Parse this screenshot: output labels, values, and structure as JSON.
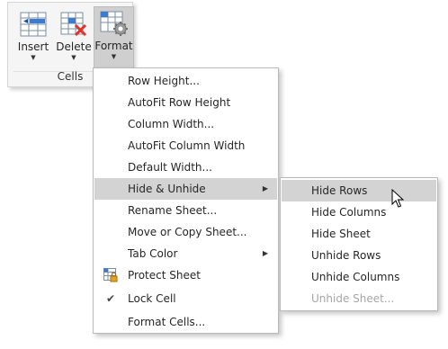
{
  "ribbon": {
    "group_label": "Cells",
    "buttons": [
      {
        "label": "Insert",
        "icon": "insert-cells-icon"
      },
      {
        "label": "Delete",
        "icon": "delete-cells-icon"
      },
      {
        "label": "Format",
        "icon": "format-cells-icon"
      }
    ]
  },
  "menu": {
    "items": [
      {
        "label": "Row Height..."
      },
      {
        "label": "AutoFit Row Height"
      },
      {
        "label": "Column Width..."
      },
      {
        "label": "AutoFit Column Width"
      },
      {
        "label": "Default Width..."
      },
      {
        "label": "Hide & Unhide",
        "submenu": true,
        "highlighted": true
      },
      {
        "label": "Rename Sheet..."
      },
      {
        "label": "Move or Copy Sheet..."
      },
      {
        "label": "Tab Color",
        "submenu": true
      },
      {
        "label": "Protect Sheet",
        "icon": "protect-sheet-icon"
      },
      {
        "label": "Lock Cell",
        "icon": "checkmark-icon"
      },
      {
        "label": "Format Cells..."
      }
    ]
  },
  "submenu": {
    "items": [
      {
        "label": "Hide Rows",
        "highlighted": true
      },
      {
        "label": "Hide Columns"
      },
      {
        "label": "Hide Sheet"
      },
      {
        "label": "Unhide Rows"
      },
      {
        "label": "Unhide Columns"
      },
      {
        "label": "Unhide Sheet...",
        "disabled": true
      }
    ]
  },
  "colors": {
    "highlight": "#d3d3d3",
    "disabled_text": "#a6a6a6",
    "delete_red": "#e0312b"
  },
  "glyphs": {
    "dropdown_arrow": "▼",
    "submenu_arrow": "▶",
    "check": "✔"
  }
}
